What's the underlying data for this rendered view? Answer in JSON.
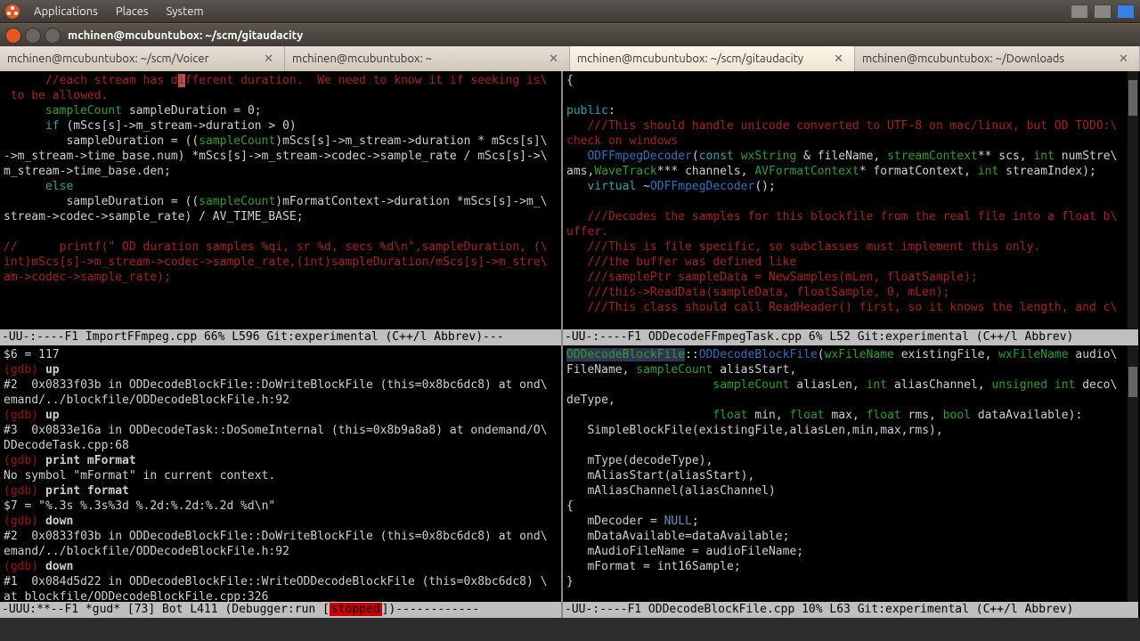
{
  "menubar": {
    "items": [
      "Applications",
      "Places",
      "System"
    ]
  },
  "window": {
    "title": "mchinen@mcubuntubox: ~/scm/gitaudacity"
  },
  "tabs": [
    {
      "label": "mchinen@mcubuntubox: ~/scm/Voicer"
    },
    {
      "label": "mchinen@mcubuntubox: ~"
    },
    {
      "label": "mchinen@mcubuntubox: ~/scm/gitaudacity",
      "active": true
    },
    {
      "label": "mchinen@mcubuntubox: ~/Downloads"
    }
  ],
  "pane_tl": {
    "lines": {
      "l1a": "      //each stream has d",
      "l1b": "i",
      "l1c": "fferent duration.  We need to know it if seeking is\\",
      "l2": " to be allowed.",
      "l3a": "      ",
      "l3b": "sampleCount",
      "l3c": " sampleDuration = 0;",
      "l4a": "      ",
      "l4b": "if",
      "l4c": " (mScs[s]->m_stream->duration > 0)",
      "l5a": "         sampleDuration = ((",
      "l5b": "sampleCount",
      "l5c": ")mScs[s]->m_stream->duration * mScs[s]\\",
      "l6": "->m_stream->time_base.num) *mScs[s]->m_stream->codec->sample_rate / mScs[s]->\\",
      "l7": "m_stream->time_base.den;",
      "l8a": "      ",
      "l8b": "else",
      "l9a": "         sampleDuration = ((",
      "l9b": "sampleCount",
      "l9c": ")mFormatContext->duration *mScs[s]->m_\\",
      "l10": "stream->codec->sample_rate) / AV_TIME_BASE;",
      "l12": "//      printf(\" OD duration samples %qi, sr %d, secs %d\\n\",sampleDuration, (\\",
      "l13": "int)mScs[s]->m_stream->codec->sample_rate,(int)sampleDuration/mScs[s]->m_stre\\",
      "l14": "am->codec->sample_rate);"
    },
    "modeline": "-UU-:----F1  ImportFFmpeg.cpp    66% L596   Git:experimental  (C++/l Abbrev)---"
  },
  "pane_bl": {
    "gdb": {
      "r1": "$6 = 117",
      "p1": "(gdb) ",
      "c1": "up",
      "r2a": "#2  0x0833f03b in ODDecodeBlockFile::DoWriteBlockFile (this=0x8bc6dc8) at ond\\",
      "r2b": "emand/../blockfile/ODDecodeBlockFile.h:92",
      "p2": "(gdb) ",
      "c2": "up",
      "r3a": "#3  0x0833e16a in ODDecodeTask::DoSomeInternal (this=0x8b9a8a8) at ondemand/O\\",
      "r3b": "DDecodeTask.cpp:68",
      "p3": "(gdb) ",
      "c3": "print mFormat",
      "r4": "No symbol \"mFormat\" in current context.",
      "p4": "(gdb) ",
      "c4": "print format",
      "r5": "$7 = \"%.3s %.3s%3d %.2d:%.2d:%.2d %d\\n\"",
      "p5": "(gdb) ",
      "c5": "down",
      "r6a": "#2  0x0833f03b in ODDecodeBlockFile::DoWriteBlockFile (this=0x8bc6dc8) at ond\\",
      "r6b": "emand/../blockfile/ODDecodeBlockFile.h:92",
      "p6": "(gdb) ",
      "c6": "down",
      "r7a": "#1  0x084d5d22 in ODDecodeBlockFile::WriteODDecodeBlockFile (this=0x8bc6dc8) \\",
      "r7b": "at blockfile/ODDecodeBlockFile.cpp:326",
      "p7": "(gdb) "
    },
    "modeline_pre": "-UUU:**--F1  *gud*         [73]    Bot L411   (Debugger:run [",
    "modeline_stop": "stopped",
    "modeline_post": "])------------"
  },
  "pane_tr": {
    "lines": {
      "l0": "{",
      "l1a": "public",
      "l1b": ":",
      "l2a": "   ///This should handle unicode converted to UTF-8 on mac/linux, but OD TODO:\\",
      "l2b": "check on windows",
      "l3a": "   ODFFmpegDecoder",
      "l3b": "(",
      "l3c": "const ",
      "l3d": "wxString",
      "l3e": " & fileName, ",
      "l3f": "streamContext",
      "l3g": "** scs, ",
      "l3h": "int",
      "l3i": " numStre\\",
      "l4a": "ams,",
      "l4b": "WaveTrack",
      "l4c": "*** channels, ",
      "l4d": "AVFormatContext",
      "l4e": "* formatContext, ",
      "l4f": "int",
      "l4g": " streamIndex);",
      "l5a": "   ",
      "l5b": "virtual ",
      "l5c": "~",
      "l5d": "ODFFmpegDecoder",
      "l5e": "();",
      "l7a": "   ///Decodes the samples for this blockfile from the real file into a float b\\",
      "l7b": "uffer.",
      "l8": "   ///This is file specific, so subclasses must implement this only.",
      "l9": "   ///the buffer was defined like",
      "l10": "   ///samplePtr sampleData = NewSamples(mLen, floatSample);",
      "l11": "   ///this->ReadData(sampleData, floatSample, 0, mLen);",
      "l12": "   ///This class should call ReadHeader() first, so it knows the length, and c\\"
    },
    "modeline": "-UU-:----F1  ODDecodeFFmpegTask.cpp   6% L52    Git:experimental  (C++/l Abbrev)"
  },
  "pane_br": {
    "lines": {
      "l1a": "ODDecodeBlockFile",
      "l1b": "::",
      "l1c": "ODDecodeBlockFile",
      "l1d": "(",
      "l1e": "wxFileName",
      "l1f": " existingFile, ",
      "l1g": "wxFileName",
      "l1h": " audio\\",
      "l2a": "FileName, ",
      "l2b": "sampleCount",
      "l2c": " aliasStart,",
      "l3a": "                     ",
      "l3b": "sampleCount",
      "l3c": " aliasLen, ",
      "l3d": "int",
      "l3e": " aliasChannel, ",
      "l3f": "unsigned int",
      "l3g": " deco\\",
      "l4": "deType,",
      "l5a": "                     ",
      "l5b": "float",
      "l5c": " min, ",
      "l5d": "float",
      "l5e": " max, ",
      "l5f": "float",
      "l5g": " rms, ",
      "l5h": "bool",
      "l5i": " dataAvailable):",
      "l6": "   SimpleBlockFile(existingFile,aliasLen,min,max,rms),",
      "l8": "   mType(decodeType),",
      "l9": "   mAliasStart(aliasStart),",
      "l10": "   mAliasChannel(aliasChannel)",
      "l11": "{",
      "l12a": "   mDecoder = ",
      "l12b": "NULL",
      "l12c": ";",
      "l13": "   mDataAvailable=dataAvailable;",
      "l14": "   mAudioFileName = audioFileName;",
      "l15": "   mFormat = int16Sample;",
      "l16": "}"
    },
    "modeline": "-UU-:----F1  ODDecodeBlockFile.cpp   10% L63    Git:experimental  (C++/l Abbrev)"
  }
}
